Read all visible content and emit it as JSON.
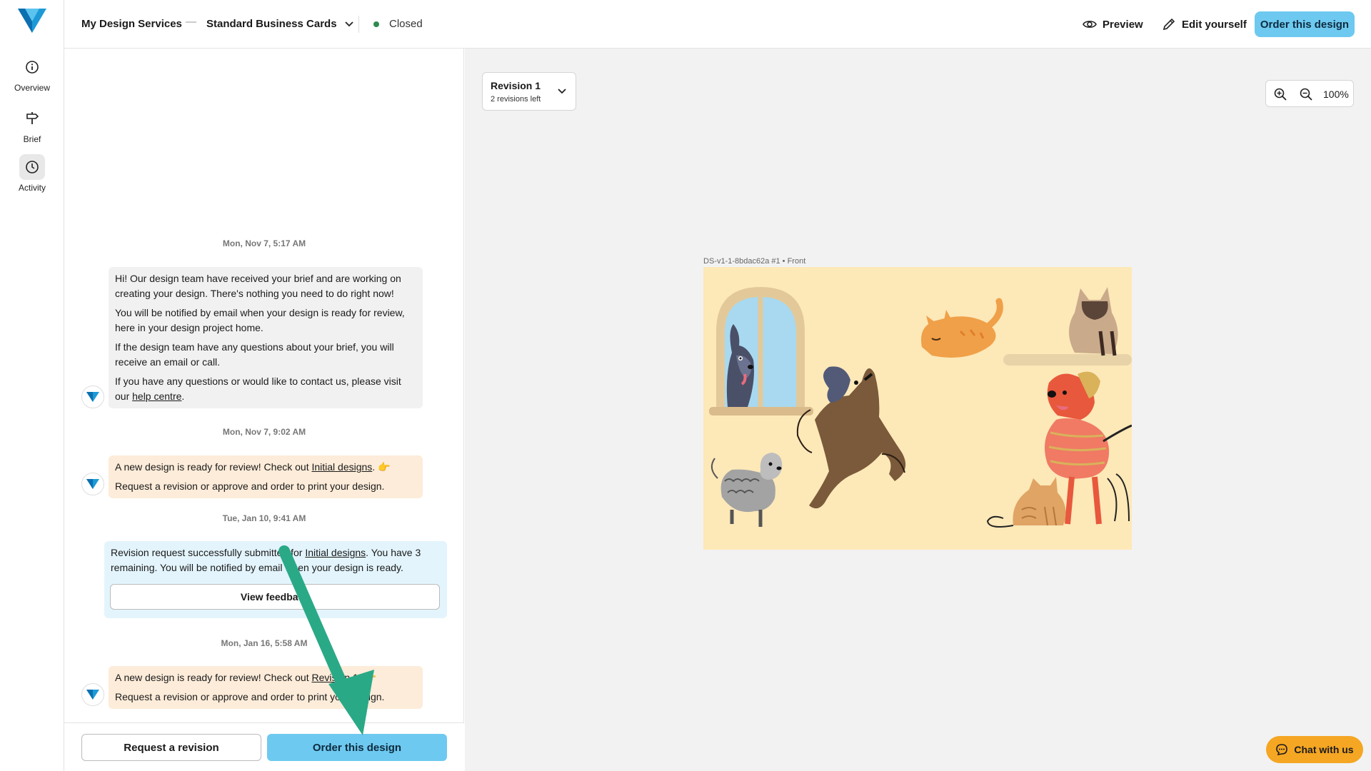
{
  "header": {
    "breadcrumb_root": "My Design Services",
    "breadcrumb_separator": "—",
    "product": "Standard Business Cards",
    "status": "Closed",
    "preview_label": "Preview",
    "edit_label": "Edit yourself",
    "order_label": "Order this design"
  },
  "rail": {
    "items": [
      {
        "label": "Overview",
        "icon": "info-icon"
      },
      {
        "label": "Brief",
        "icon": "signpost-icon"
      },
      {
        "label": "Activity",
        "icon": "clock-icon"
      }
    ]
  },
  "activity": {
    "messages": [
      {
        "timestamp": "Mon, Nov 7, 5:17 AM",
        "paragraphs": [
          "Hi! Our design team have received your brief and are working on creating your design. There's nothing you need to do right now!",
          "You will be notified by email when your design is ready for review, here in your design project home.",
          "If the design team have any questions about your brief, you will receive an email or call."
        ],
        "last_prefix": "If you have any questions or would like to contact us, please visit our ",
        "link": "help centre",
        "last_suffix": "."
      },
      {
        "timestamp": "Mon, Nov 7, 9:02 AM",
        "prefix": "A new design is ready for review! Check out ",
        "link": "Initial designs",
        "suffix": ". 👉",
        "line2": "Request a revision or approve and order to print your design."
      },
      {
        "timestamp": "Tue, Jan 10, 9:41 AM",
        "prefix": "Revision request successfully submitted for ",
        "link": "Initial designs",
        "suffix": ". You have 3 remaining. You will be notified by email when your design is ready.",
        "button": "View feedback"
      },
      {
        "timestamp": "Mon, Jan 16, 5:58 AM",
        "prefix": "A new design is ready for review! Check out ",
        "link": "Revision 1",
        "suffix": ". 👉",
        "line2": "Request a revision or approve and order to print your design."
      }
    ],
    "footer": {
      "request_label": "Request a revision",
      "order_label": "Order this design"
    }
  },
  "canvas": {
    "revision_title": "Revision 1",
    "revision_sub": "2 revisions left",
    "zoom_level": "100%",
    "card_label": "DS-v1-1-8bdac62a #1 • Front"
  },
  "chat": {
    "label": "Chat with us"
  },
  "colors": {
    "accent": "#6ec9f0",
    "status_green": "#2e8b4f",
    "chat_orange": "#f5a623",
    "annotation_arrow": "#2aa987"
  }
}
